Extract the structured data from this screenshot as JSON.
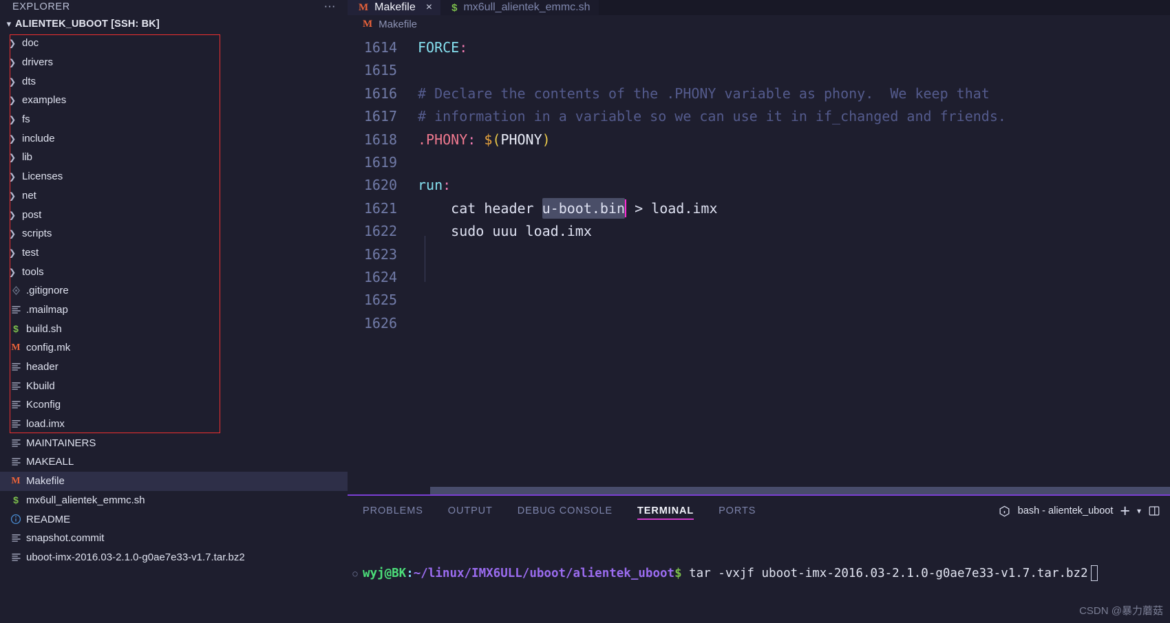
{
  "sidebar": {
    "title": "EXPLORER",
    "more_icon": "ellipsis-icon",
    "root": {
      "label": "ALIENTEK_UBOOT [SSH: BK]",
      "chevron": "chevron-down-icon"
    },
    "items": [
      {
        "name": "doc",
        "kind": "folder",
        "icon": "chevron-right-icon"
      },
      {
        "name": "drivers",
        "kind": "folder",
        "icon": "chevron-right-icon"
      },
      {
        "name": "dts",
        "kind": "folder",
        "icon": "chevron-right-icon"
      },
      {
        "name": "examples",
        "kind": "folder",
        "icon": "chevron-right-icon"
      },
      {
        "name": "fs",
        "kind": "folder",
        "icon": "chevron-right-icon"
      },
      {
        "name": "include",
        "kind": "folder",
        "icon": "chevron-right-icon"
      },
      {
        "name": "lib",
        "kind": "folder",
        "icon": "chevron-right-icon"
      },
      {
        "name": "Licenses",
        "kind": "folder",
        "icon": "chevron-right-icon"
      },
      {
        "name": "net",
        "kind": "folder",
        "icon": "chevron-right-icon"
      },
      {
        "name": "post",
        "kind": "folder",
        "icon": "chevron-right-icon"
      },
      {
        "name": "scripts",
        "kind": "folder",
        "icon": "chevron-right-icon"
      },
      {
        "name": "test",
        "kind": "folder",
        "icon": "chevron-right-icon"
      },
      {
        "name": "tools",
        "kind": "folder",
        "icon": "chevron-right-icon"
      },
      {
        "name": ".gitignore",
        "kind": "file",
        "icon": "git-icon"
      },
      {
        "name": ".mailmap",
        "kind": "file",
        "icon": "text-file-icon"
      },
      {
        "name": "build.sh",
        "kind": "file",
        "icon": "shell-script-icon"
      },
      {
        "name": "config.mk",
        "kind": "file",
        "icon": "makefile-icon"
      },
      {
        "name": "header",
        "kind": "file",
        "icon": "text-file-icon"
      },
      {
        "name": "Kbuild",
        "kind": "file",
        "icon": "text-file-icon"
      },
      {
        "name": "Kconfig",
        "kind": "file",
        "icon": "text-file-icon"
      },
      {
        "name": "load.imx",
        "kind": "file",
        "icon": "text-file-icon"
      },
      {
        "name": "MAINTAINERS",
        "kind": "file",
        "icon": "text-file-icon"
      },
      {
        "name": "MAKEALL",
        "kind": "file",
        "icon": "text-file-icon"
      },
      {
        "name": "Makefile",
        "kind": "file",
        "icon": "makefile-icon",
        "selected": true
      },
      {
        "name": "mx6ull_alientek_emmc.sh",
        "kind": "file",
        "icon": "shell-script-icon"
      },
      {
        "name": "README",
        "kind": "file",
        "icon": "info-icon"
      },
      {
        "name": "snapshot.commit",
        "kind": "file",
        "icon": "text-file-icon"
      },
      {
        "name": "uboot-imx-2016.03-2.1.0-g0ae7e33-v1.7.tar.bz2",
        "kind": "file",
        "icon": "text-file-icon"
      }
    ],
    "annotation_color": "#f03030"
  },
  "editor": {
    "tabs": [
      {
        "label": "Makefile",
        "icon": "makefile-icon",
        "active": true,
        "close": "×"
      },
      {
        "label": "mx6ull_alientek_emmc.sh",
        "icon": "shell-script-icon",
        "active": false
      }
    ],
    "breadcrumb": {
      "icon": "makefile-icon",
      "label": "Makefile"
    },
    "lines": [
      {
        "num": "1614",
        "text": "FORCE:"
      },
      {
        "num": "1615",
        "text": ""
      },
      {
        "num": "1616",
        "text": "# Declare the contents of the .PHONY variable as phony.  We keep that"
      },
      {
        "num": "1617",
        "text": "# information in a variable so we can use it in if_changed and friends."
      },
      {
        "num": "1618",
        "text": ".PHONY: $(PHONY)"
      },
      {
        "num": "1619",
        "text": ""
      },
      {
        "num": "1620",
        "text": "run:"
      },
      {
        "num": "1621",
        "text": "    cat header u-boot.bin > load.imx"
      },
      {
        "num": "1622",
        "text": "    sudo uuu load.imx"
      },
      {
        "num": "1623",
        "text": ""
      },
      {
        "num": "1624",
        "text": ""
      },
      {
        "num": "1625",
        "text": ""
      },
      {
        "num": "1626",
        "text": ""
      }
    ],
    "tokens": {
      "l1614_target": "FORCE",
      "l1614_colon": ":",
      "l1616_comment": "# Declare the contents of the .PHONY variable as phony.  We keep that",
      "l1617_comment": "# information in a variable so we can use it in if_changed and friends.",
      "l1618_phony": ".PHONY",
      "l1618_colon": ":",
      "l1618_dollar": "$",
      "l1618_open": "(",
      "l1618_var": "PHONY",
      "l1618_close": ")",
      "l1620_target": "run",
      "l1620_colon": ":",
      "l1621_pre": "    cat header ",
      "l1621_selected": "u-boot.bin",
      "l1621_post": " > load.imx",
      "l1622_text": "    sudo uuu load.imx"
    },
    "colors": {
      "target": "#86e1f0",
      "comment": "#545b8d",
      "phony": "#f0798f",
      "selection_bg": "#4a4e68",
      "caret": "#ff2ad4",
      "background": "#1e1e2e"
    }
  },
  "panel": {
    "tabs": [
      {
        "label": "PROBLEMS",
        "active": false
      },
      {
        "label": "OUTPUT",
        "active": false
      },
      {
        "label": "DEBUG CONSOLE",
        "active": false
      },
      {
        "label": "TERMINAL",
        "active": true
      },
      {
        "label": "PORTS",
        "active": false
      }
    ],
    "actions": {
      "terminal_name": "bash - alientek_uboot",
      "terminal_icon": "terminal-box-icon",
      "new_terminal_icon": "+",
      "dropdown_icon": "chevron-down-icon",
      "split_icon": "split-panel-icon"
    },
    "terminal": {
      "user_host": "wyj@BK",
      "colon": ":",
      "path": "~/linux/IMX6ULL/uboot/alientek_uboot",
      "prompt_symbol": "$",
      "command": " tar -vxjf uboot-imx-2016.03-2.1.0-g0ae7e33-v1.7.tar.bz2",
      "marker": "○"
    },
    "accent_border": "#7b3fd4",
    "active_tab_underline": "#cf3cc9"
  },
  "watermark": "CSDN @暴力蘑菇"
}
